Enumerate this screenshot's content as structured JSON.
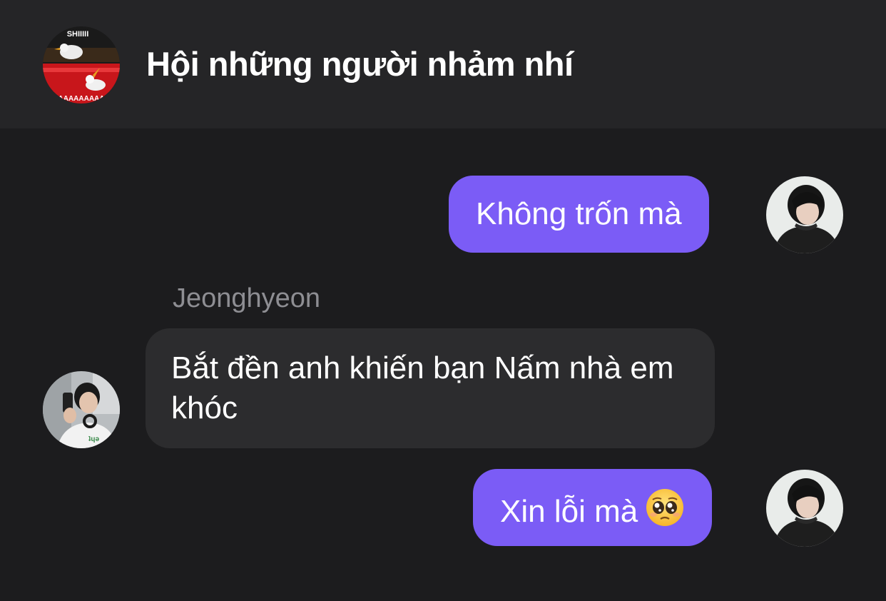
{
  "header": {
    "title": "Hội những người nhảm nhí",
    "avatar_caption_top": "SHIIIII",
    "avatar_caption_bottom": "AAAAAAAAA"
  },
  "messages": [
    {
      "direction": "outgoing",
      "text": "Không trốn mà"
    },
    {
      "direction": "incoming",
      "sender": "Jeonghyeon",
      "text": "Bắt đền anh khiến bạn Nấm nhà em khóc"
    },
    {
      "direction": "outgoing",
      "text": "Xin lỗi mà",
      "emoji": "pleading-face"
    }
  ],
  "colors": {
    "header_bg": "#252527",
    "chat_bg": "#1c1c1e",
    "outgoing_bubble": "#7b5cf6",
    "incoming_bubble": "#2c2c2e",
    "sender_name": "#8e8e93"
  }
}
